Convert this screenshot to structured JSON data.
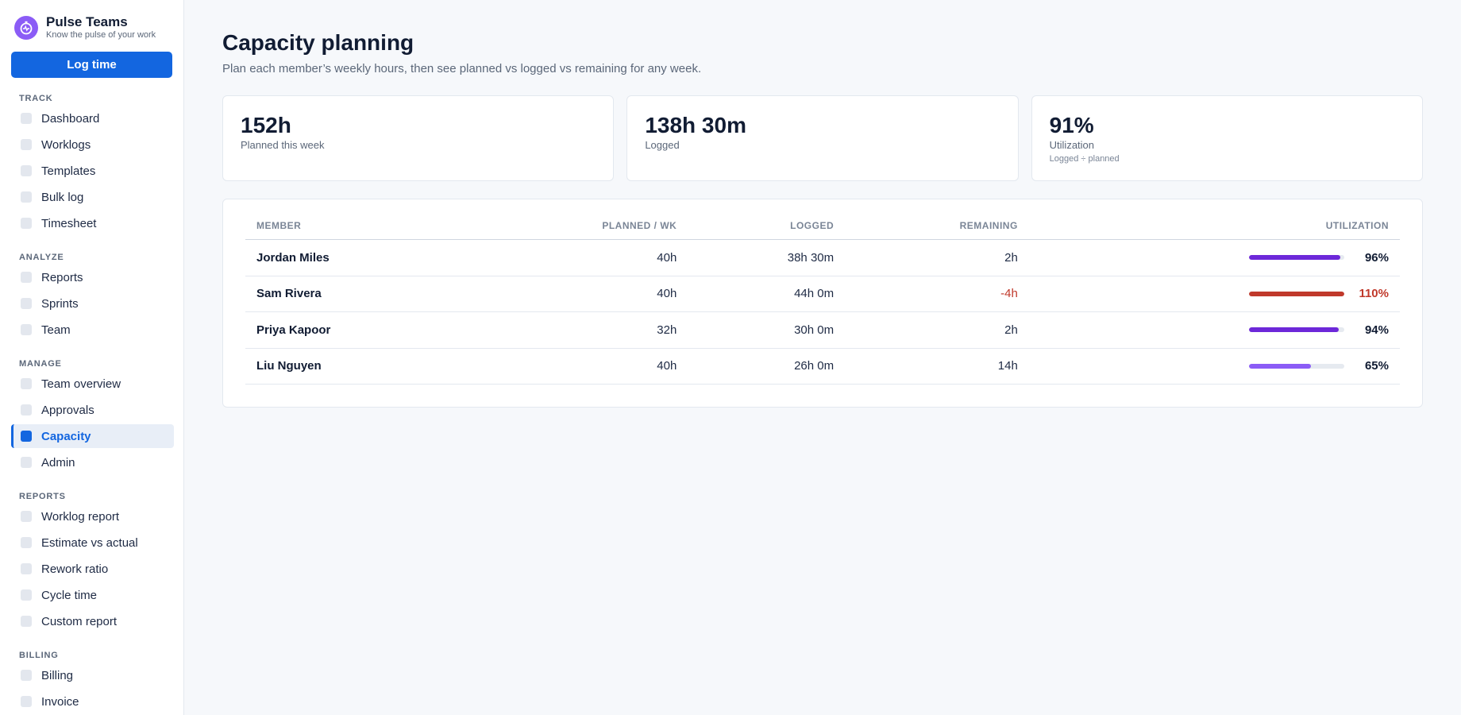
{
  "app": {
    "name": "Pulse Teams",
    "tagline": "Know the pulse of your work",
    "log_button": "Log time"
  },
  "sidebar": {
    "sections": [
      {
        "label": "TRACK",
        "items": [
          {
            "label": "Dashboard",
            "active": false
          },
          {
            "label": "Worklogs",
            "active": false
          },
          {
            "label": "Templates",
            "active": false
          },
          {
            "label": "Bulk log",
            "active": false
          },
          {
            "label": "Timesheet",
            "active": false
          }
        ]
      },
      {
        "label": "ANALYZE",
        "items": [
          {
            "label": "Reports",
            "active": false
          },
          {
            "label": "Sprints",
            "active": false
          },
          {
            "label": "Team",
            "active": false
          }
        ]
      },
      {
        "label": "MANAGE",
        "items": [
          {
            "label": "Team overview",
            "active": false
          },
          {
            "label": "Approvals",
            "active": false
          },
          {
            "label": "Capacity",
            "active": true
          },
          {
            "label": "Admin",
            "active": false
          }
        ]
      },
      {
        "label": "REPORTS",
        "items": [
          {
            "label": "Worklog report",
            "active": false
          },
          {
            "label": "Estimate vs actual",
            "active": false
          },
          {
            "label": "Rework ratio",
            "active": false
          },
          {
            "label": "Cycle time",
            "active": false
          },
          {
            "label": "Custom report",
            "active": false
          }
        ]
      },
      {
        "label": "BILLING",
        "items": [
          {
            "label": "Billing",
            "active": false
          },
          {
            "label": "Invoice",
            "active": false
          }
        ]
      }
    ]
  },
  "page": {
    "title": "Capacity planning",
    "subtitle": "Plan each member’s weekly hours, then see planned vs logged vs remaining for any week."
  },
  "stats": [
    {
      "value": "152h",
      "label": "Planned this week",
      "note": ""
    },
    {
      "value": "138h 30m",
      "label": "Logged",
      "note": ""
    },
    {
      "value": "91%",
      "label": "Utilization",
      "note": "Logged ÷ planned"
    }
  ],
  "table": {
    "headers": {
      "member": "MEMBER",
      "planned": "PLANNED / WK",
      "logged": "LOGGED",
      "remaining": "REMAINING",
      "utilization": "UTILIZATION"
    },
    "rows": [
      {
        "member": "Jordan Miles",
        "planned": "40h",
        "logged": "38h 30m",
        "remaining": "2h",
        "utilization": "96%",
        "util_fraction": 0.96,
        "bar_color": "#6d28d9",
        "negative": false
      },
      {
        "member": "Sam Rivera",
        "planned": "40h",
        "logged": "44h 0m",
        "remaining": "-4h",
        "utilization": "110%",
        "util_fraction": 1.0,
        "bar_color": "#c0392b",
        "negative": true
      },
      {
        "member": "Priya Kapoor",
        "planned": "32h",
        "logged": "30h 0m",
        "remaining": "2h",
        "utilization": "94%",
        "util_fraction": 0.94,
        "bar_color": "#6d28d9",
        "negative": false
      },
      {
        "member": "Liu Nguyen",
        "planned": "40h",
        "logged": "26h 0m",
        "remaining": "14h",
        "utilization": "65%",
        "util_fraction": 0.65,
        "bar_color": "#8b5cf6",
        "negative": false
      }
    ]
  }
}
